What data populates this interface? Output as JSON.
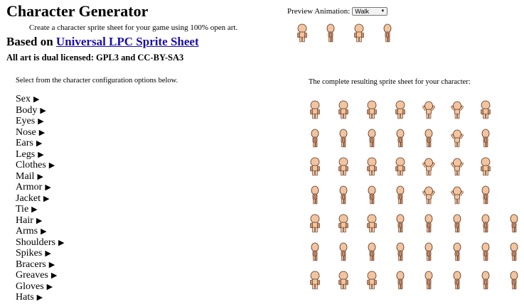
{
  "header": {
    "title": "Character Generator",
    "tagline": "Create a character sprite sheet for your game using 100% open art.",
    "based_on_prefix": "Based on ",
    "based_on_link": "Universal LPC Sprite Sheet",
    "license": "All art is dual licensed: GPL3 and CC-BY-SA3"
  },
  "preview": {
    "label": "Preview Animation:",
    "selected": "Walk"
  },
  "config": {
    "intro": "Select from the character configuration options below.",
    "options": [
      "Sex",
      "Body",
      "Eyes",
      "Nose",
      "Ears",
      "Legs",
      "Clothes",
      "Mail",
      "Armor",
      "Jacket",
      "Tie",
      "Hair",
      "Arms",
      "Shoulders",
      "Spikes",
      "Bracers",
      "Greaves",
      "Gloves",
      "Hats"
    ]
  },
  "sheet": {
    "intro": "The complete resulting sprite sheet for your character:"
  },
  "colors": {
    "skin": "#f0c59f",
    "skin_shadow": "#c98f6a",
    "outline": "#5a2e1c",
    "link": "#1a0dab"
  }
}
